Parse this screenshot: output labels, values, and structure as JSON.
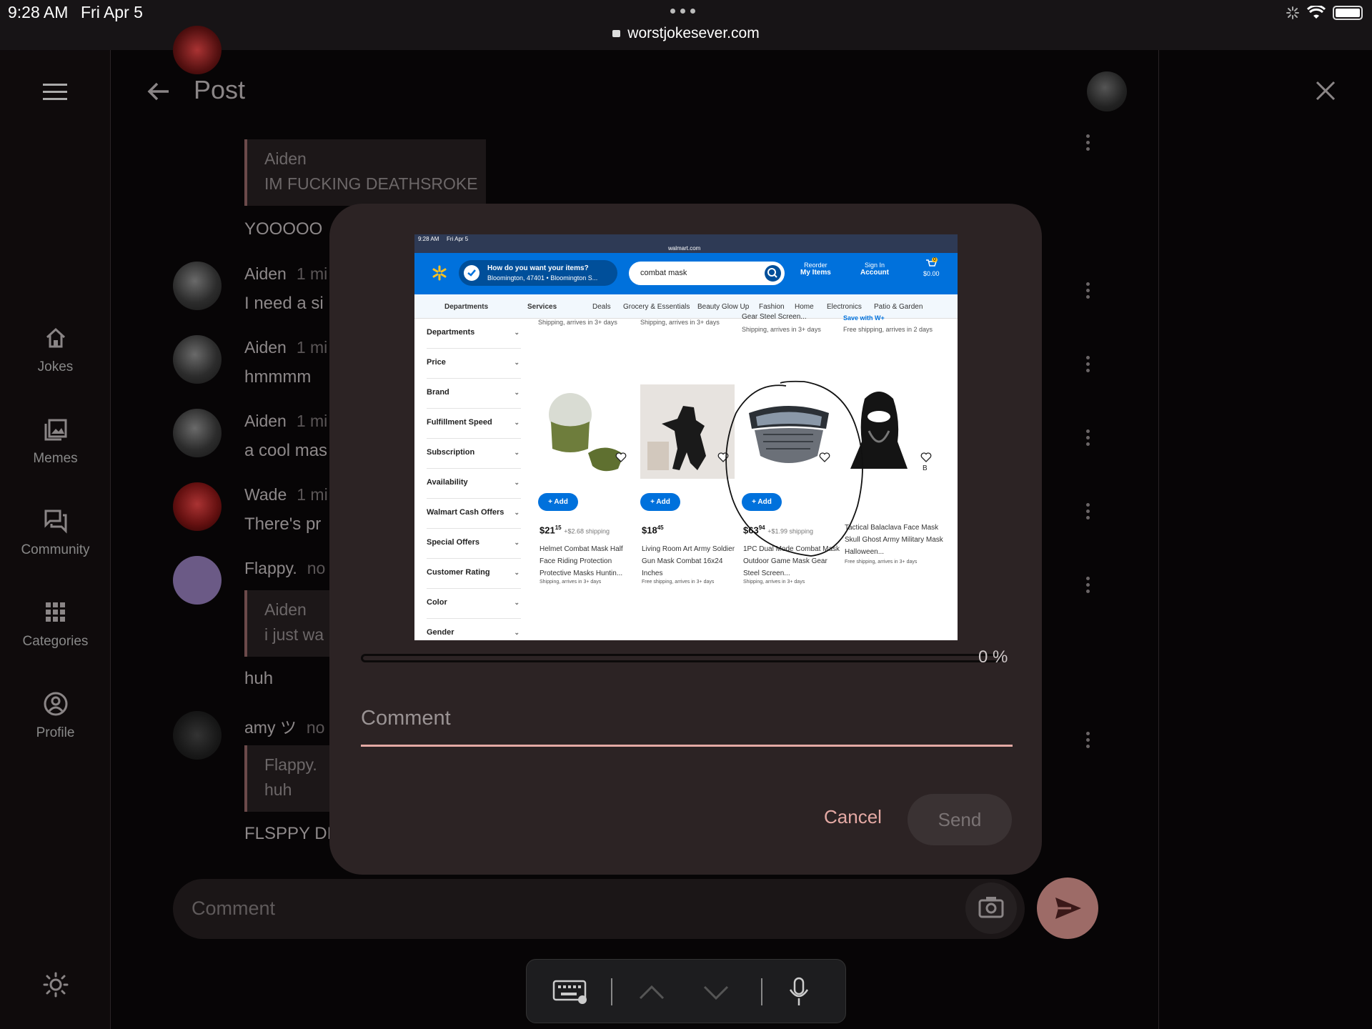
{
  "status_bar": {
    "time": "9:28 AM",
    "date": "Fri Apr 5",
    "url": "worstjokesever.com"
  },
  "sidebar": {
    "items": [
      {
        "label": "Jokes",
        "icon": "home-icon"
      },
      {
        "label": "Memes",
        "icon": "image-icon"
      },
      {
        "label": "Community",
        "icon": "forum-icon"
      },
      {
        "label": "Categories",
        "icon": "grid-icon"
      },
      {
        "label": "Profile",
        "icon": "account-icon"
      }
    ],
    "theme_icon": "sun-icon"
  },
  "header": {
    "title": "Post"
  },
  "thread": {
    "quote1": {
      "name": "Aiden",
      "text": "IM FUCKING DEATHSROKE"
    },
    "msg_yo": "YOOOOO",
    "c1": {
      "name": "Aiden",
      "ago": "1 mi",
      "text": "I need a si"
    },
    "c2": {
      "name": "Aiden",
      "ago": "1 mi",
      "text": "hmmmm"
    },
    "c3": {
      "name": "Aiden",
      "ago": "1 mi",
      "text": "a cool mas"
    },
    "c4": {
      "name": "Wade",
      "ago": "1 mi",
      "text": "There's pr"
    },
    "c5": {
      "name": "Flappy.",
      "ago": "no",
      "quote_name": "Aiden",
      "quote_text": "i just wa",
      "text": "huh"
    },
    "c6": {
      "name": "amy ツ",
      "ago": "no",
      "quote_name": "Flappy.",
      "quote_text": "huh",
      "text": "FLSPPY DI"
    }
  },
  "comment_bar": {
    "placeholder": "Comment"
  },
  "dialog": {
    "progress_percent": 0,
    "progress_label": "0 %",
    "comment_placeholder": "Comment",
    "cancel_label": "Cancel",
    "send_label": "Send"
  },
  "attachment": {
    "status_time": "9:28 AM",
    "status_date": "Fri Apr 5",
    "url": "walmart.com",
    "location_title": "How do you want your items?",
    "location_sub": "Bloomington, 47401 • Bloomington S...",
    "search_value": "combat mask",
    "reorder_small": "Reorder",
    "reorder_big": "My Items",
    "signin_small": "Sign In",
    "signin_big": "Account",
    "cart_count": "0",
    "cart_total": "$0.00",
    "nav": [
      "Departments",
      "Services",
      "Deals",
      "Grocery & Essentials",
      "Beauty Glow Up",
      "Fashion",
      "Home",
      "Electronics",
      "Patio & Garden"
    ],
    "filters": [
      "Departments",
      "Price",
      "Brand",
      "Fulfillment Speed",
      "Subscription",
      "Availability",
      "Walmart Cash Offers",
      "Special Offers",
      "Customer Rating",
      "Color",
      "Gender"
    ],
    "prev_row": [
      "Shipping, arrives in 3+ days",
      "Shipping, arrives in 3+ days",
      "Gear Steel Screen...",
      "Shipping, arrives in 3+ days",
      "Save with W+",
      "Free shipping, arrives in 2 days"
    ],
    "products": [
      {
        "price": "$21",
        "cents": "15",
        "extra": "+$2.68 shipping",
        "desc": "Helmet Combat Mask Half Face Riding Protection Protective Masks Huntin...",
        "ship": "Shipping, arrives in 3+ days",
        "add": "Add"
      },
      {
        "price": "$18",
        "cents": "45",
        "extra": "",
        "desc": "Living Room Art Army Soldier Gun Mask Combat 16x24 Inches",
        "ship": "Free shipping, arrives in 3+ days",
        "add": "Add"
      },
      {
        "price": "$63",
        "cents": "94",
        "extra": "+$1.99 shipping",
        "desc": "1PC Dual Mode Combat Mask Outdoor Game Mask Gear Steel Screen...",
        "ship": "Shipping, arrives in 3+ days",
        "add": "Add"
      },
      {
        "price": "",
        "cents": "",
        "extra": "",
        "desc": "Tactical Balaclava Face Mask Skull Ghost Army Military Mask Halloween...",
        "ship": "Free shipping, arrives in 3+ days",
        "add": ""
      }
    ],
    "edge_letter": "B"
  },
  "keyboard_bar": {
    "icons": [
      "keyboard-icon",
      "chevron-up-icon",
      "chevron-down-icon",
      "microphone-icon"
    ]
  }
}
